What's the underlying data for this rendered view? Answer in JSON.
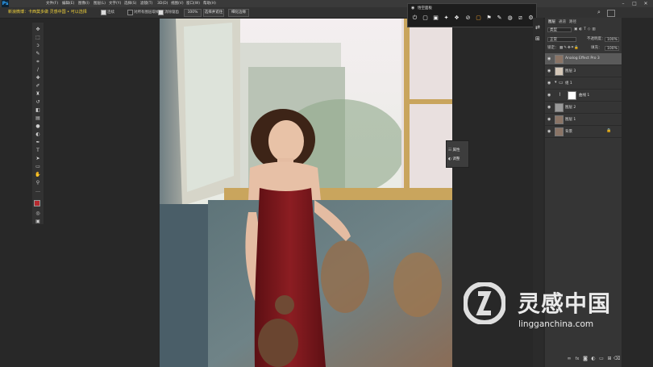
{
  "app": {
    "logo": "Ps"
  },
  "menu": [
    "文件(F)",
    "编辑(E)",
    "图像(I)",
    "图层(L)",
    "文字(Y)",
    "选择(S)",
    "滤镜(T)",
    "3D(D)",
    "视图(V)",
    "窗口(W)",
    "帮助(H)"
  ],
  "window_controls": [
    "–",
    "□",
    "✕"
  ],
  "overlay_text": "新浪微博：卡西莫多做 灵感中国 • 可以选择",
  "options_bar": {
    "contiguous_label": "连续",
    "sample_all_layers_label": "对所有图层取样",
    "anti_alias_label": "消除锯齿",
    "auto_enhance_label": "自动增强",
    "opacity_value": "100%",
    "select_subject": "选择并遮住",
    "refine_label": "细化边缘",
    "search_icon": "search-icon"
  },
  "tools": [
    "move-icon",
    "marquee-icon",
    "lasso-icon",
    "quick-select-icon",
    "crop-icon",
    "eyedropper-icon",
    "healing-icon",
    "brush-icon",
    "stamp-icon",
    "history-brush-icon",
    "eraser-icon",
    "gradient-icon",
    "blur-icon",
    "dodge-icon",
    "pen-icon",
    "type-icon",
    "path-select-icon",
    "shape-icon",
    "hand-icon",
    "zoom-icon",
    "more-icon"
  ],
  "colors": {
    "foreground": "#b52a2f",
    "background": "#ffffff",
    "accent": "#31a8ff"
  },
  "floating_toolbar": {
    "title": "悟空面板",
    "icons": [
      "power-icon",
      "chat-icon",
      "image-icon",
      "gift-icon",
      "layers-icon",
      "share-icon",
      "frame-icon",
      "flag-icon",
      "brush-icon",
      "mask-icon",
      "crop-icon",
      "gear-icon"
    ]
  },
  "props_panel": {
    "items": [
      {
        "label": "属性",
        "icon": "properties-icon"
      },
      {
        "label": "调整",
        "icon": "adjust-icon"
      }
    ]
  },
  "layers_panel": {
    "tabs": [
      "图层",
      "通道",
      "路径"
    ],
    "kind_label": "类型",
    "blend_mode": "正常",
    "opacity_label": "不透明度：",
    "opacity_value": "100%",
    "lock_label": "锁定：",
    "fill_label": "填充：",
    "fill_value": "100%",
    "layers": [
      {
        "name": "Analog Effect Pro 3",
        "selected": true,
        "thumb": "#8a7466"
      },
      {
        "name": "图层 3",
        "selected": false,
        "thumb": "#d4c7b8"
      },
      {
        "name": "组 1",
        "selected": false,
        "thumb": ""
      },
      {
        "name": "曲线 1",
        "selected": false,
        "thumb": "#ffffff"
      },
      {
        "name": "图层 2",
        "selected": false,
        "thumb": "#9a9a9a"
      },
      {
        "name": "图层 1",
        "selected": false,
        "thumb": "#8a7466"
      },
      {
        "name": "背景",
        "selected": false,
        "thumb": "#8a7466"
      }
    ],
    "footer_icons": [
      "link-icon",
      "fx-icon",
      "mask-icon",
      "adjustment-icon",
      "folder-icon",
      "new-layer-icon",
      "trash-icon"
    ]
  },
  "watermark": {
    "cn": "灵感中国",
    "en": "lingganchina.com"
  }
}
